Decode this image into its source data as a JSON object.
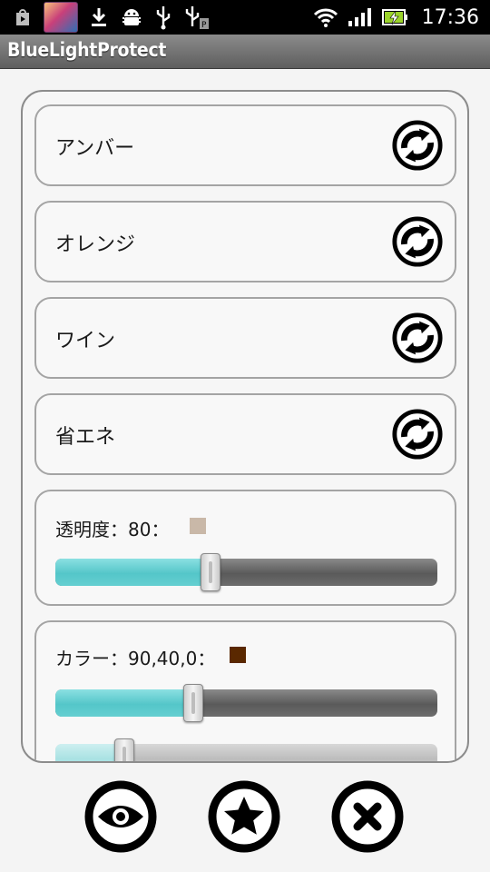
{
  "status_bar": {
    "time": "17:36",
    "icons": [
      "play-store-icon",
      "game-notification-thumbnail",
      "download-icon",
      "android-debug-icon",
      "usb-icon",
      "usb-storage-icon",
      "wifi-icon",
      "signal-icon",
      "battery-charging-icon"
    ]
  },
  "app": {
    "title": "BlueLightProtect"
  },
  "presets": [
    {
      "label": "アンバー",
      "icon": "sync-icon"
    },
    {
      "label": "オレンジ",
      "icon": "sync-icon"
    },
    {
      "label": "ワイン",
      "icon": "sync-icon"
    },
    {
      "label": "省エネ",
      "icon": "sync-icon"
    }
  ],
  "transparency": {
    "label": "透明度：80：",
    "value": 80,
    "swatch_color": "#c9b8a8",
    "slider_fraction": 0.405
  },
  "color": {
    "label": "カラー：90,40,0：",
    "swatch_color": "#5a2800",
    "slider1_fraction": 0.36,
    "slider2_fraction": 0.18
  },
  "bottom_buttons": [
    {
      "name": "preview-eye-button",
      "icon": "eye-icon"
    },
    {
      "name": "favorite-star-button",
      "icon": "star-icon"
    },
    {
      "name": "close-button",
      "icon": "close-icon"
    }
  ],
  "colors": {
    "accent": "#54c6c9",
    "title_bar": "#6e6e6e",
    "background": "#f4f4f4"
  }
}
